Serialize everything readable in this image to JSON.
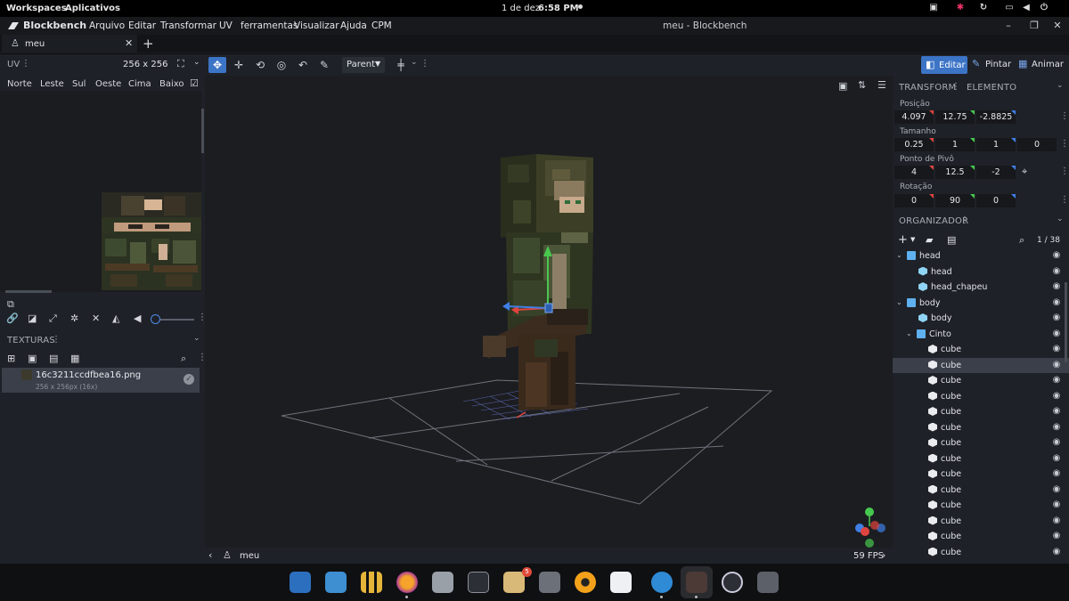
{
  "system": {
    "workspaces": "Workspaces",
    "apps": "Aplicativos",
    "date": "1 de dez",
    "time": "6:58 PM"
  },
  "app": {
    "name": "Blockbench",
    "window_title": "meu - Blockbench",
    "menu": [
      "Arquivo",
      "Editar",
      "Transformar",
      "UV",
      "ferramentas",
      "Visualizar",
      "Ajuda",
      "CPM"
    ]
  },
  "tabs": [
    {
      "label": "meu"
    }
  ],
  "toolbar": {
    "parent_select": "Parent",
    "modes": {
      "edit": "Editar",
      "paint": "Pintar",
      "animate": "Animar"
    }
  },
  "uv_panel": {
    "title": "UV",
    "size": "256 x 256",
    "faces": [
      "Norte",
      "Leste",
      "Sul",
      "Oeste",
      "Cima",
      "Baixo"
    ]
  },
  "textures": {
    "title": "TEXTURAS",
    "items": [
      {
        "name": "16c3211ccdfbea16.png",
        "info": "256 x 256px (16x)"
      }
    ]
  },
  "viewport": {
    "model_name": "meu",
    "fps": "59 FPS"
  },
  "transform": {
    "tab_transform": "TRANSFORM",
    "tab_element": "ELEMENTO",
    "position_label": "Posição",
    "position": [
      "4.097",
      "12.75",
      "-2.8825"
    ],
    "size_label": "Tamanho",
    "size": [
      "0.25",
      "1",
      "1",
      "0"
    ],
    "pivot_label": "Ponto de Pivô",
    "pivot": [
      "4",
      "12.5",
      "-2"
    ],
    "rotation_label": "Rotação",
    "rotation": [
      "0",
      "90",
      "0"
    ]
  },
  "outliner": {
    "title": "ORGANIZADOR",
    "count": "1 / 38",
    "rows": [
      {
        "label": "head",
        "type": "group",
        "depth": 0
      },
      {
        "label": "head",
        "type": "cube",
        "depth": 1
      },
      {
        "label": "head_chapeu",
        "type": "cube",
        "depth": 1
      },
      {
        "label": "body",
        "type": "group",
        "depth": 0
      },
      {
        "label": "body",
        "type": "cube",
        "depth": 1
      },
      {
        "label": "Cinto",
        "type": "group",
        "depth": 1
      },
      {
        "label": "cube",
        "type": "cube",
        "depth": 2
      },
      {
        "label": "cube",
        "type": "cube",
        "depth": 2,
        "selected": true
      },
      {
        "label": "cube",
        "type": "cube",
        "depth": 2
      },
      {
        "label": "cube",
        "type": "cube",
        "depth": 2
      },
      {
        "label": "cube",
        "type": "cube",
        "depth": 2
      },
      {
        "label": "cube",
        "type": "cube",
        "depth": 2
      },
      {
        "label": "cube",
        "type": "cube",
        "depth": 2
      },
      {
        "label": "cube",
        "type": "cube",
        "depth": 2
      },
      {
        "label": "cube",
        "type": "cube",
        "depth": 2
      },
      {
        "label": "cube",
        "type": "cube",
        "depth": 2
      },
      {
        "label": "cube",
        "type": "cube",
        "depth": 2
      },
      {
        "label": "cube",
        "type": "cube",
        "depth": 2
      },
      {
        "label": "cube",
        "type": "cube",
        "depth": 2
      },
      {
        "label": "cube",
        "type": "cube",
        "depth": 2
      }
    ]
  },
  "colors": {
    "accent": "#3c74c6",
    "axis_x": "#e0443e",
    "axis_y": "#47c84e",
    "axis_z": "#3f7fe6"
  },
  "dock": {
    "badge": "5",
    "apps": [
      "search-app",
      "screenshot-app",
      "apps-grid",
      "firefox",
      "files",
      "terminal",
      "archive-manager",
      "settings",
      "rhythmbox",
      "vscode",
      "proton-vpn",
      "blockbench",
      "obs",
      "camera"
    ]
  }
}
